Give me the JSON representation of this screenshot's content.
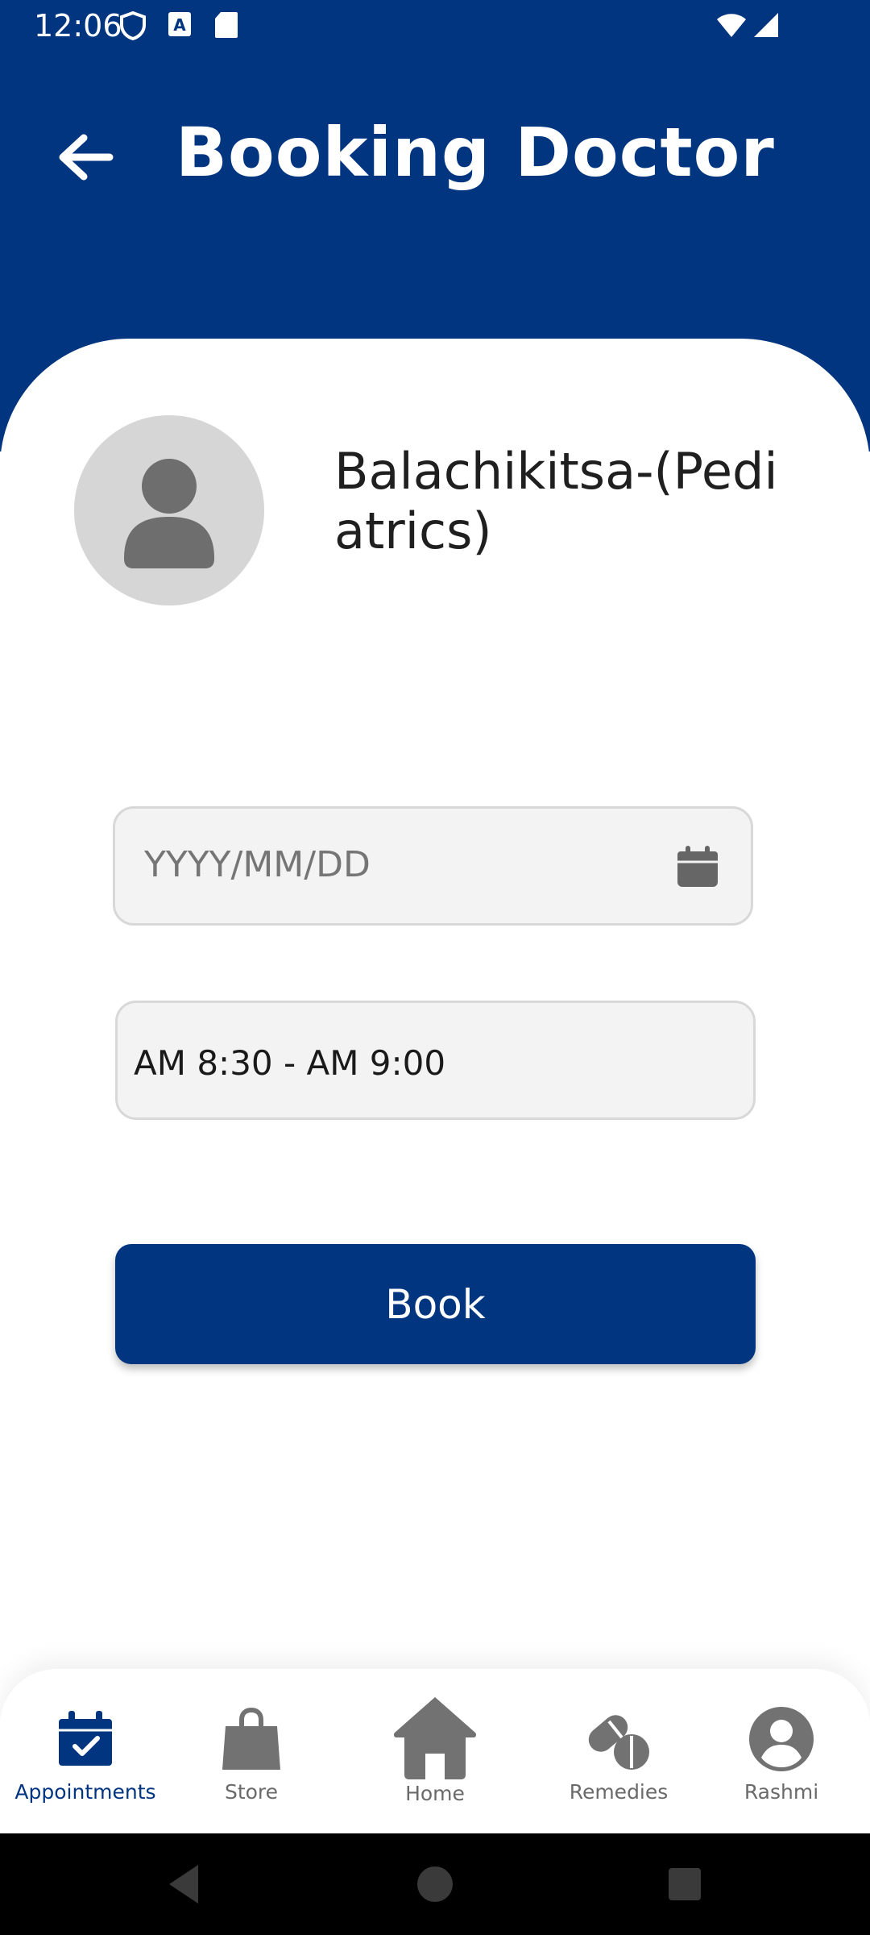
{
  "status_bar": {
    "time": "12:06"
  },
  "header": {
    "title": "Booking Doctor"
  },
  "doctor": {
    "name": "Balachikitsa-(Pediatrics)"
  },
  "form": {
    "date_placeholder": "YYYY/MM/DD",
    "date_value": "",
    "time_slot": "AM 8:30 - AM 9:00"
  },
  "actions": {
    "book_label": "Book"
  },
  "bottom_nav": {
    "items": [
      {
        "label": "Appointments",
        "icon": "calendar-check-icon",
        "active": true
      },
      {
        "label": "Store",
        "icon": "shopping-bag-icon",
        "active": false
      },
      {
        "label": "Home",
        "icon": "home-icon",
        "active": false
      },
      {
        "label": "Remedies",
        "icon": "pills-icon",
        "active": false
      },
      {
        "label": "Rashmi",
        "icon": "user-circle-icon",
        "active": false
      }
    ]
  },
  "colors": {
    "primary": "#023580",
    "inactive": "#6a6a6a",
    "field_bg": "#f3f3f3"
  }
}
